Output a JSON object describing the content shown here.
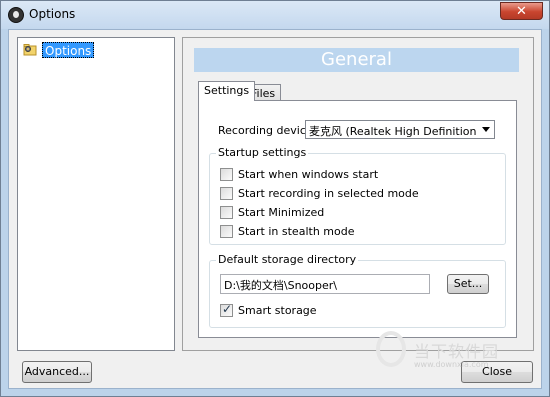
{
  "window": {
    "title": "Options",
    "close_label": "✕"
  },
  "tree": {
    "items": [
      {
        "label": "Options"
      }
    ]
  },
  "panel": {
    "header": "General",
    "tabs": [
      {
        "label": "Settings"
      },
      {
        "label": "Files"
      }
    ],
    "recording_device": {
      "label": "Recording device",
      "selected": "麦克风 (Realtek High Definition"
    },
    "startup": {
      "title": "Startup settings",
      "options": [
        {
          "label": "Start when windows start",
          "checked": false
        },
        {
          "label": "Start recording in selected mode",
          "checked": false
        },
        {
          "label": "Start Minimized",
          "checked": false
        },
        {
          "label": "Start in stealth mode",
          "checked": false
        }
      ]
    },
    "storage": {
      "title": "Default storage directory",
      "path": "D:\\我的文档\\Snooper\\",
      "set_label": "Set...",
      "smart_storage": {
        "label": "Smart storage",
        "checked": true
      }
    }
  },
  "footer": {
    "advanced_label": "Advanced...",
    "close_label": "Close"
  },
  "watermark": {
    "text": "当下软件园",
    "url": "www.downxia.com"
  }
}
